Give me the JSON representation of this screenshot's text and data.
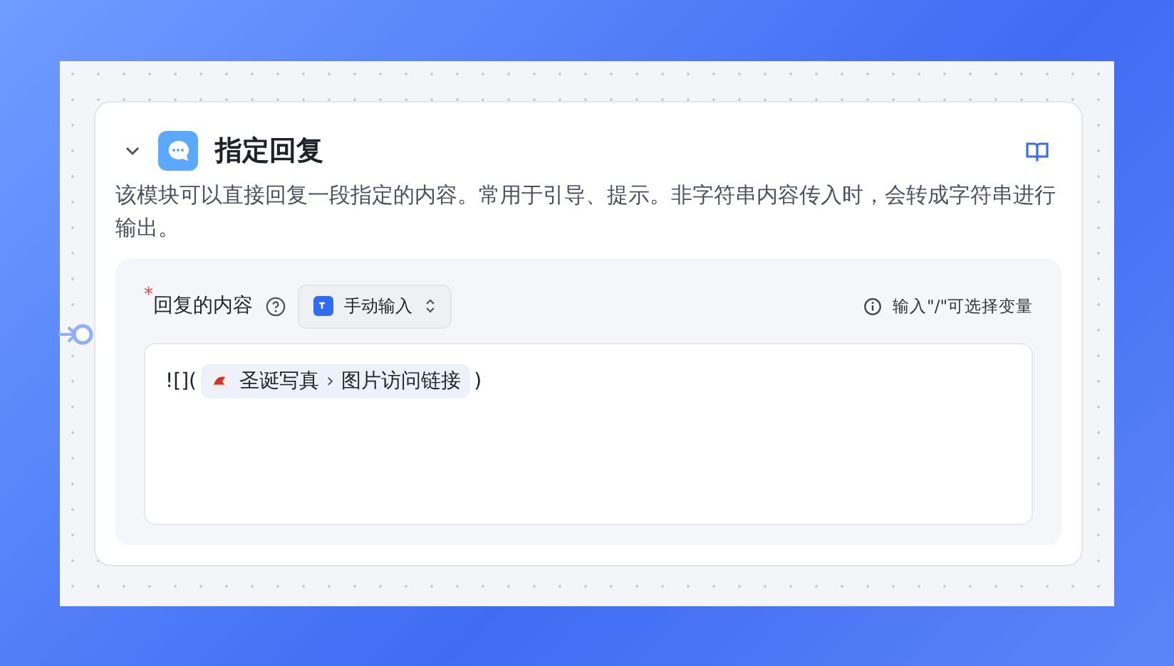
{
  "node": {
    "title": "指定回复",
    "expanded": true,
    "description": "该模块可以直接回复一段指定的内容。常用于引导、提示。非字符串内容传入时，会转成字符串进行输出。"
  },
  "field": {
    "label": "回复的内容",
    "required": true,
    "required_mark": "*",
    "input_mode": "手动输入",
    "hint": "输入\"/\"可选择变量",
    "content": {
      "prefix": "![](",
      "variable": {
        "source": "圣诞写真",
        "separator": "›",
        "name": "图片访问链接"
      },
      "suffix": ")"
    }
  }
}
